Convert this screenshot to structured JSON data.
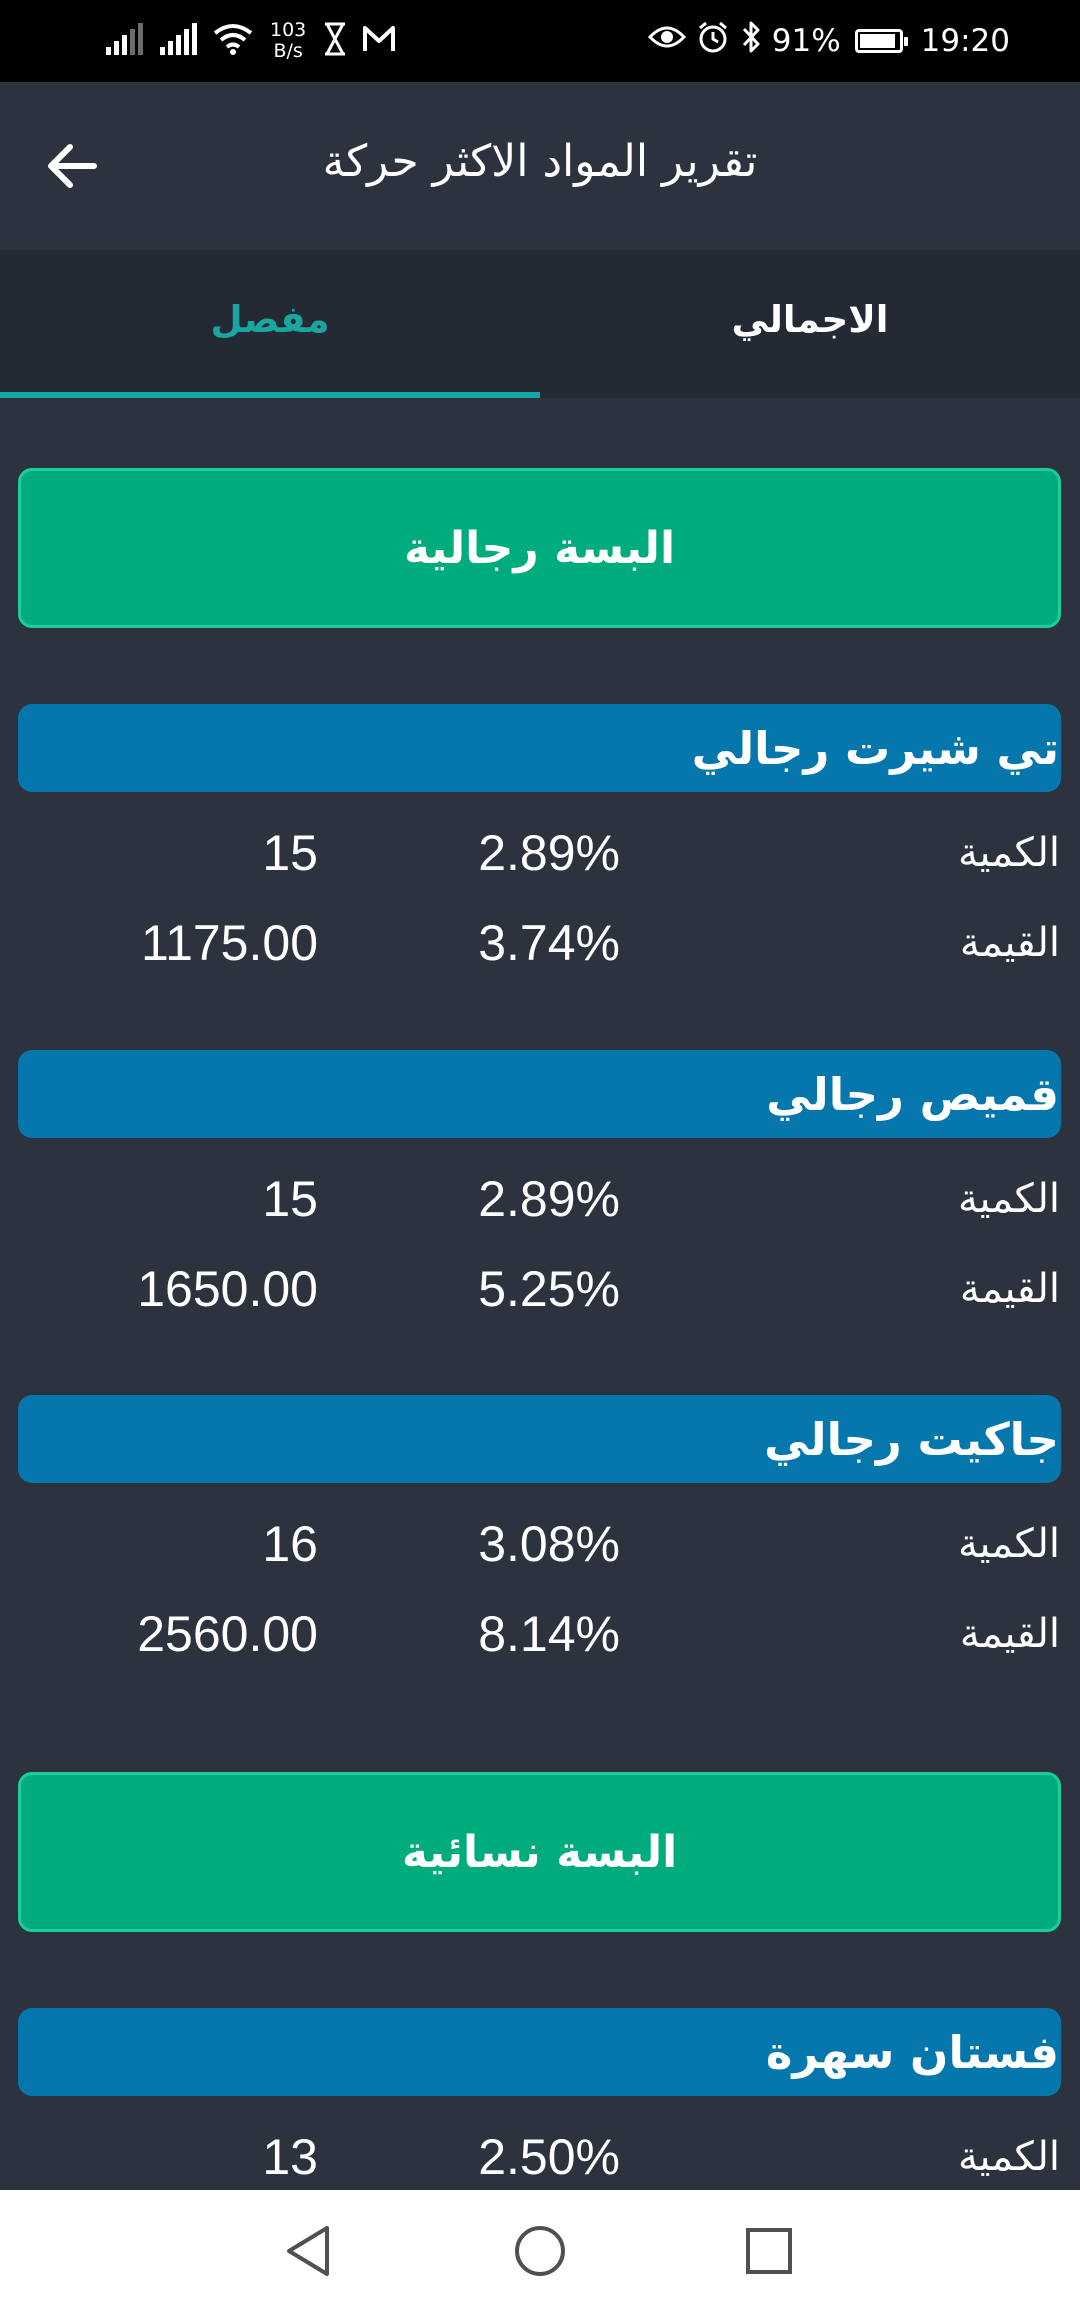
{
  "status_bar": {
    "net_speed_value": "103",
    "net_speed_unit": "B/s",
    "battery_text": "91%",
    "battery_level": 0.91,
    "time": "19:20",
    "icons": [
      "signal-icon",
      "signal-icon",
      "wifi-icon",
      "hourglass-icon",
      "gmail-icon",
      "eye-icon",
      "alarm-icon",
      "bluetooth-icon",
      "battery-icon"
    ]
  },
  "app_bar": {
    "title": "تقرير المواد الاكثر حركة",
    "back_icon": "arrow-left-icon"
  },
  "tabs": {
    "detailed": "مفصل",
    "total": "الاجمالي",
    "active": "detailed",
    "accent_color": "#1aa6a0"
  },
  "categories": [
    {
      "name": "البسة رجالية"
    },
    {
      "name": "البسة نسائية"
    }
  ],
  "items": [
    {
      "name": "تي شيرت رجالي",
      "quantity_label": "الكمية",
      "quantity_percent": "2.89%",
      "quantity_value": "15",
      "value_label": "القيمة",
      "value_percent": "3.74%",
      "value_value": "1175.00"
    },
    {
      "name": "قميص رجالي",
      "quantity_label": "الكمية",
      "quantity_percent": "2.89%",
      "quantity_value": "15",
      "value_label": "القيمة",
      "value_percent": "5.25%",
      "value_value": "1650.00"
    },
    {
      "name": "جاكيت رجالي",
      "quantity_label": "الكمية",
      "quantity_percent": "3.08%",
      "quantity_value": "16",
      "value_label": "القيمة",
      "value_percent": "8.14%",
      "value_value": "2560.00"
    },
    {
      "name": "فستان سهرة",
      "quantity_label": "الكمية",
      "quantity_percent": "2.50%",
      "quantity_value": "13"
    }
  ],
  "colors": {
    "background": "#2c333e",
    "tab_bar": "#242a33",
    "category_fill": "#00ab7e",
    "category_border": "#1ccf9a",
    "item_header": "#0677ad"
  },
  "nav_bar": {
    "back": "nav-back-icon",
    "home": "nav-home-icon",
    "recents": "nav-recents-icon"
  }
}
